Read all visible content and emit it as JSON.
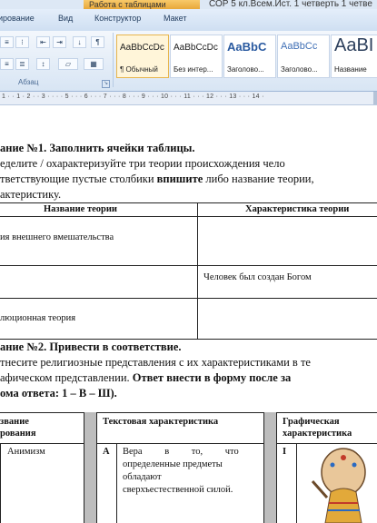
{
  "ribbon": {
    "context_tab": "Работа с таблицами",
    "doc_title": "СОР 5 кл.Всем.Ист. 1 четверть 1 четве",
    "tabs": [
      "ирование",
      "Вид",
      "Конструктор",
      "Макет"
    ],
    "group_label": "Абзац",
    "styles": [
      {
        "sample": "AaBbCcDc",
        "name": "¶ Обычный",
        "selected": true
      },
      {
        "sample": "AaBbCcDc",
        "name": "Без интер...",
        "selected": false
      },
      {
        "sample": "AaBbC",
        "name": "Заголово...",
        "selected": false
      },
      {
        "sample": "AaBbCc",
        "name": "Заголово...",
        "selected": false
      },
      {
        "sample": "AaBI",
        "name": "Название",
        "selected": false
      }
    ]
  },
  "ruler": {
    "text": "1 · · 1 · 2 · · 3 · · · · 5 · · · 6 · · · 7 · · · 8 · · · 9 · · · 10 · · · 11 · · · 12 · · · 13 · · · 14 ·"
  },
  "task1": {
    "title": "ание №1. Заполнить ячейки таблицы.",
    "line1": "еделите / охарактеризуйте три теории происхождения чело",
    "line2_a": "тветствующие пустые столбики ",
    "line2_b": "впишите",
    "line2_c": " либо название теории,",
    "line3": "актеристику.",
    "header_col1": "Название теории",
    "header_col2": "Характеристика теории",
    "rows": [
      {
        "col1": "ия внешнего вмешательства",
        "col2": ""
      },
      {
        "col1": "",
        "col2": "Человек был создан Богом"
      },
      {
        "col1": "люционная теория",
        "col2": ""
      }
    ]
  },
  "task2": {
    "title": "ание №2. Привести в соответствие.",
    "line1": "тнесите религиозные представления с их характеристиками в те",
    "line2_a": "афическом представлении. ",
    "line2_b": "Ответ внести в форму после за",
    "line3": "ома ответа: 1 – В – Ш).",
    "header_col1_l1": "звание",
    "header_col1_l2": "рования",
    "header_col2": "Текстовая характеристика",
    "header_col3_l1": "Графическая",
    "header_col3_l2": "характеристика",
    "row1_col1": "Анимизм",
    "row1_letter": "А",
    "row1_text": [
      "Вера в то, что",
      "определенные предметы",
      "обладают",
      "сверхъестественной силой."
    ],
    "row1_roman": "I"
  },
  "colors": {
    "ribbon_bg": "#dde8f5",
    "context_tab": "#f0b54e",
    "style_selected": "#fff5d9"
  }
}
